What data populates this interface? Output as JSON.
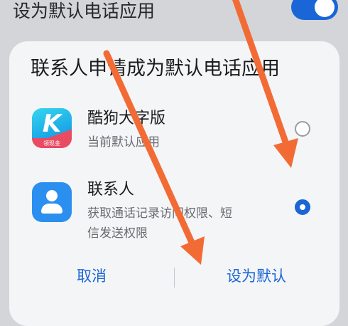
{
  "setting": {
    "label": "设为默认电话应用",
    "toggle_on": true
  },
  "dialog": {
    "title": "联系人申请成为默认电话应用",
    "options": [
      {
        "name": "酷狗大字版",
        "description": "当前默认应用",
        "icon": "kugou-app-icon",
        "icon_badge": "领现金",
        "selected": false
      },
      {
        "name": "联系人",
        "description_line1": "获取通话记录访问权限、短",
        "description_line2": "信发送权限",
        "icon": "contacts-app-icon",
        "selected": true
      }
    ],
    "cancel_label": "取消",
    "confirm_label": "设为默认"
  },
  "annotations": {
    "arrow_color": "#f26b35"
  },
  "colors": {
    "accent": "#1b66d6",
    "dialog_bg": "#f4f5f7",
    "backdrop": "#d3d5d9"
  }
}
